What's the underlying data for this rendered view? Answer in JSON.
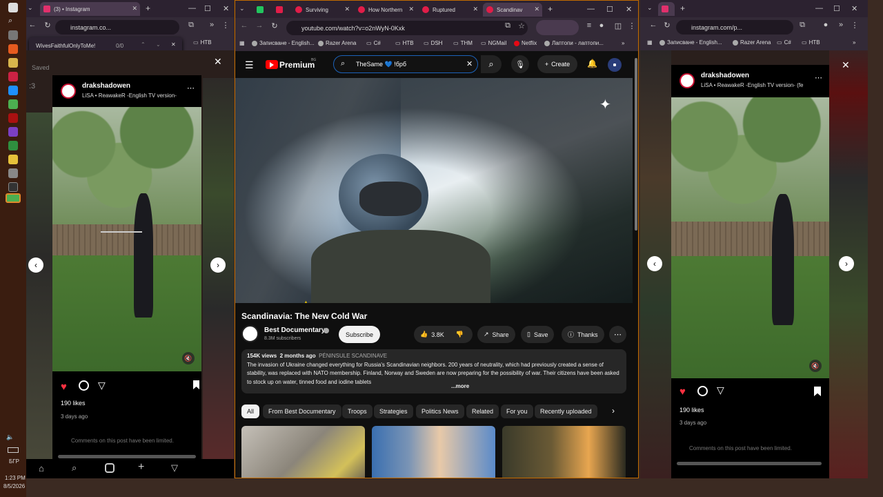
{
  "taskbar": {
    "time": "1:23 PM",
    "date": "8/5/2026",
    "lang": "БГР"
  },
  "left_window": {
    "tab_title": "(3) • Instagram",
    "url": "instagram.co...",
    "find_text": "WivesFaithfulOnlyToMe!",
    "find_count": "0/0",
    "bookmark": "НТВ",
    "saved_label": "Saved",
    "count_fragment": ":3",
    "post": {
      "username": "drakshadowen",
      "audio": "LiSA • ReawakeR -English TV version-",
      "likes": "190 likes",
      "time_ago": "3 days ago",
      "comments_note": "Comments on this post have been limited."
    }
  },
  "yt_window": {
    "tabs": [
      {
        "label": "",
        "color": "#22c55e"
      },
      {
        "label": "",
        "color": "#e11d48"
      },
      {
        "label": "Surviving",
        "color": "#e11d48"
      },
      {
        "label": "How Northern",
        "color": "#e11d48"
      },
      {
        "label": "Ruptured",
        "color": "#e11d48"
      },
      {
        "label": "Scandinav",
        "color": "#e11d48"
      }
    ],
    "url": "youtube.com/watch?v=o2nWyN-0Kxk",
    "bookmarks": [
      "Записване - English...",
      "Razer Arena",
      "C#",
      "НТВ",
      "DSH",
      "THM",
      "NGMail",
      "Netflix",
      "Лаптопи - лаптопи..."
    ],
    "logo": "Premium",
    "logo_sup": "BG",
    "search_value": "TheSame 💙 !брб",
    "create_label": "Create",
    "video": {
      "title": "Scandinavia: The New Cold War",
      "channel": "Best Documentary",
      "subscribers": "8.3M subscribers",
      "subscribe_label": "Subscribe",
      "likes": "3.8K",
      "share_label": "Share",
      "save_label": "Save",
      "thanks_label": "Thanks",
      "views": "154K views",
      "uploaded": "2 months ago",
      "hashtag": "PÉNINSULE SCANDINAVE",
      "description": "The invasion of Ukraine changed everything for Russia's Scandinavian neighbors. 200 years of neutrality, which had previously created a sense of stability, was replaced with NATO membership. Finland, Norway and Sweden are now preparing for the possibility of war. Their citizens have been asked to stock up on water, tinned food and iodine tablets",
      "more_label": "...more"
    },
    "chips": [
      "All",
      "From Best Documentary",
      "Troops",
      "Strategies",
      "Politics News",
      "Related",
      "For you",
      "Recently uploaded"
    ]
  },
  "right_window": {
    "url": "instagram.com/p...",
    "bookmarks": [
      "Записване - English...",
      "Razer Arena",
      "C#",
      "НТВ"
    ],
    "post": {
      "username": "drakshadowen",
      "audio": "LiSA • ReawakeR -English TV version- (fe",
      "likes": "190 likes",
      "time_ago": "3 days ago",
      "comments_note": "Comments on this post have been limited."
    }
  }
}
